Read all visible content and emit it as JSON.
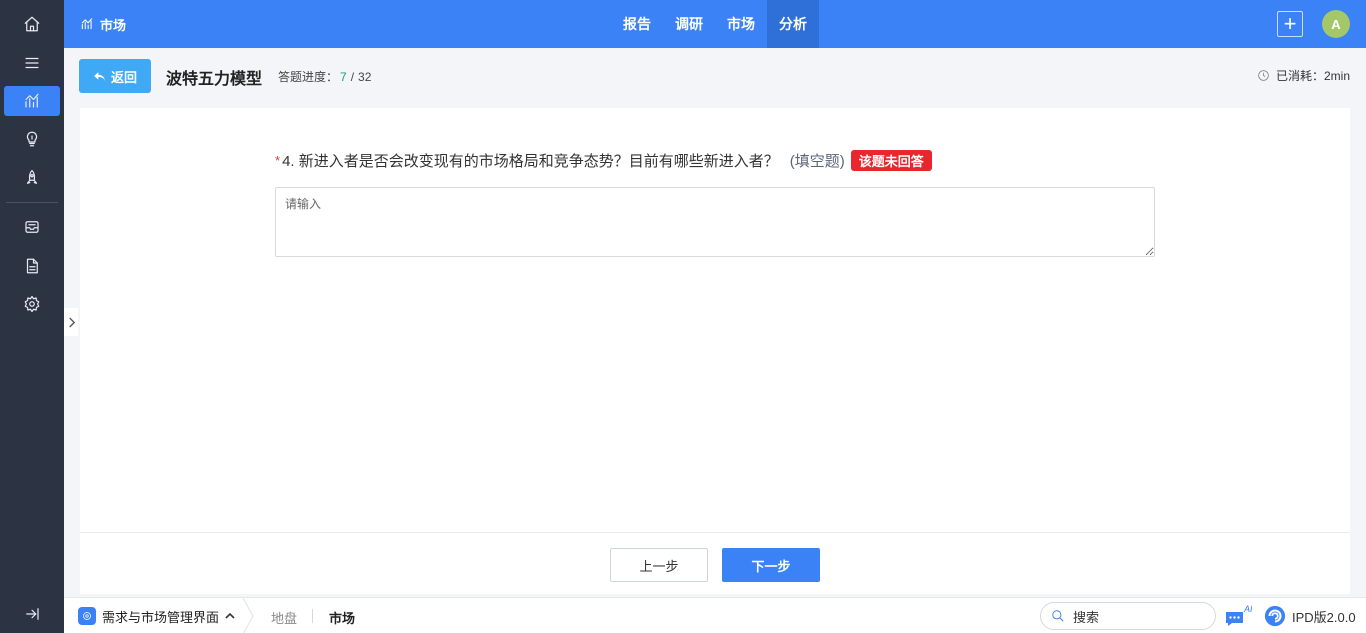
{
  "rail": {
    "items": [
      {
        "name": "home-icon"
      },
      {
        "name": "menu-icon"
      },
      {
        "name": "chart-icon",
        "active": true
      },
      {
        "name": "lightbulb-icon"
      },
      {
        "name": "rocket-icon"
      },
      {
        "name": "inbox-icon"
      },
      {
        "name": "document-icon"
      },
      {
        "name": "settings-icon"
      },
      {
        "name": "collapse-icon"
      }
    ]
  },
  "header": {
    "brand": "市场",
    "tabs": [
      {
        "label": "报告"
      },
      {
        "label": "调研"
      },
      {
        "label": "市场"
      },
      {
        "label": "分析",
        "active": true
      }
    ],
    "plus_label": "+",
    "avatar_initial": "A"
  },
  "subbar": {
    "back_label": "返回",
    "title": "波特五力模型",
    "progress_label": "答题进度：",
    "progress_current": "7",
    "progress_separator": "/",
    "progress_total": "32",
    "elapsed_label": "已消耗：",
    "elapsed_value": "2min"
  },
  "question": {
    "required_mark": "*",
    "text": "4. 新进入者是否会改变现有的市场格局和竞争态势？目前有哪些新进入者？",
    "type": "(填空题)",
    "badge": "该题未回答",
    "answer_value": "",
    "answer_placeholder": "请输入"
  },
  "actions": {
    "prev_label": "上一步",
    "next_label": "下一步"
  },
  "bottombar": {
    "module_label": "需求与市场管理界面",
    "crumb1": "地盘",
    "crumb2": "市场",
    "search_label": "搜索",
    "ai_label": "AI",
    "version_label": "IPD版2.0.0"
  },
  "colors": {
    "primary": "#3b82f6",
    "rail_bg": "#2c3444",
    "back_button": "#3fa9f5",
    "progress_current": "#22a06b",
    "unanswered_badge": "#e8262b",
    "avatar": "#a4c76a"
  }
}
